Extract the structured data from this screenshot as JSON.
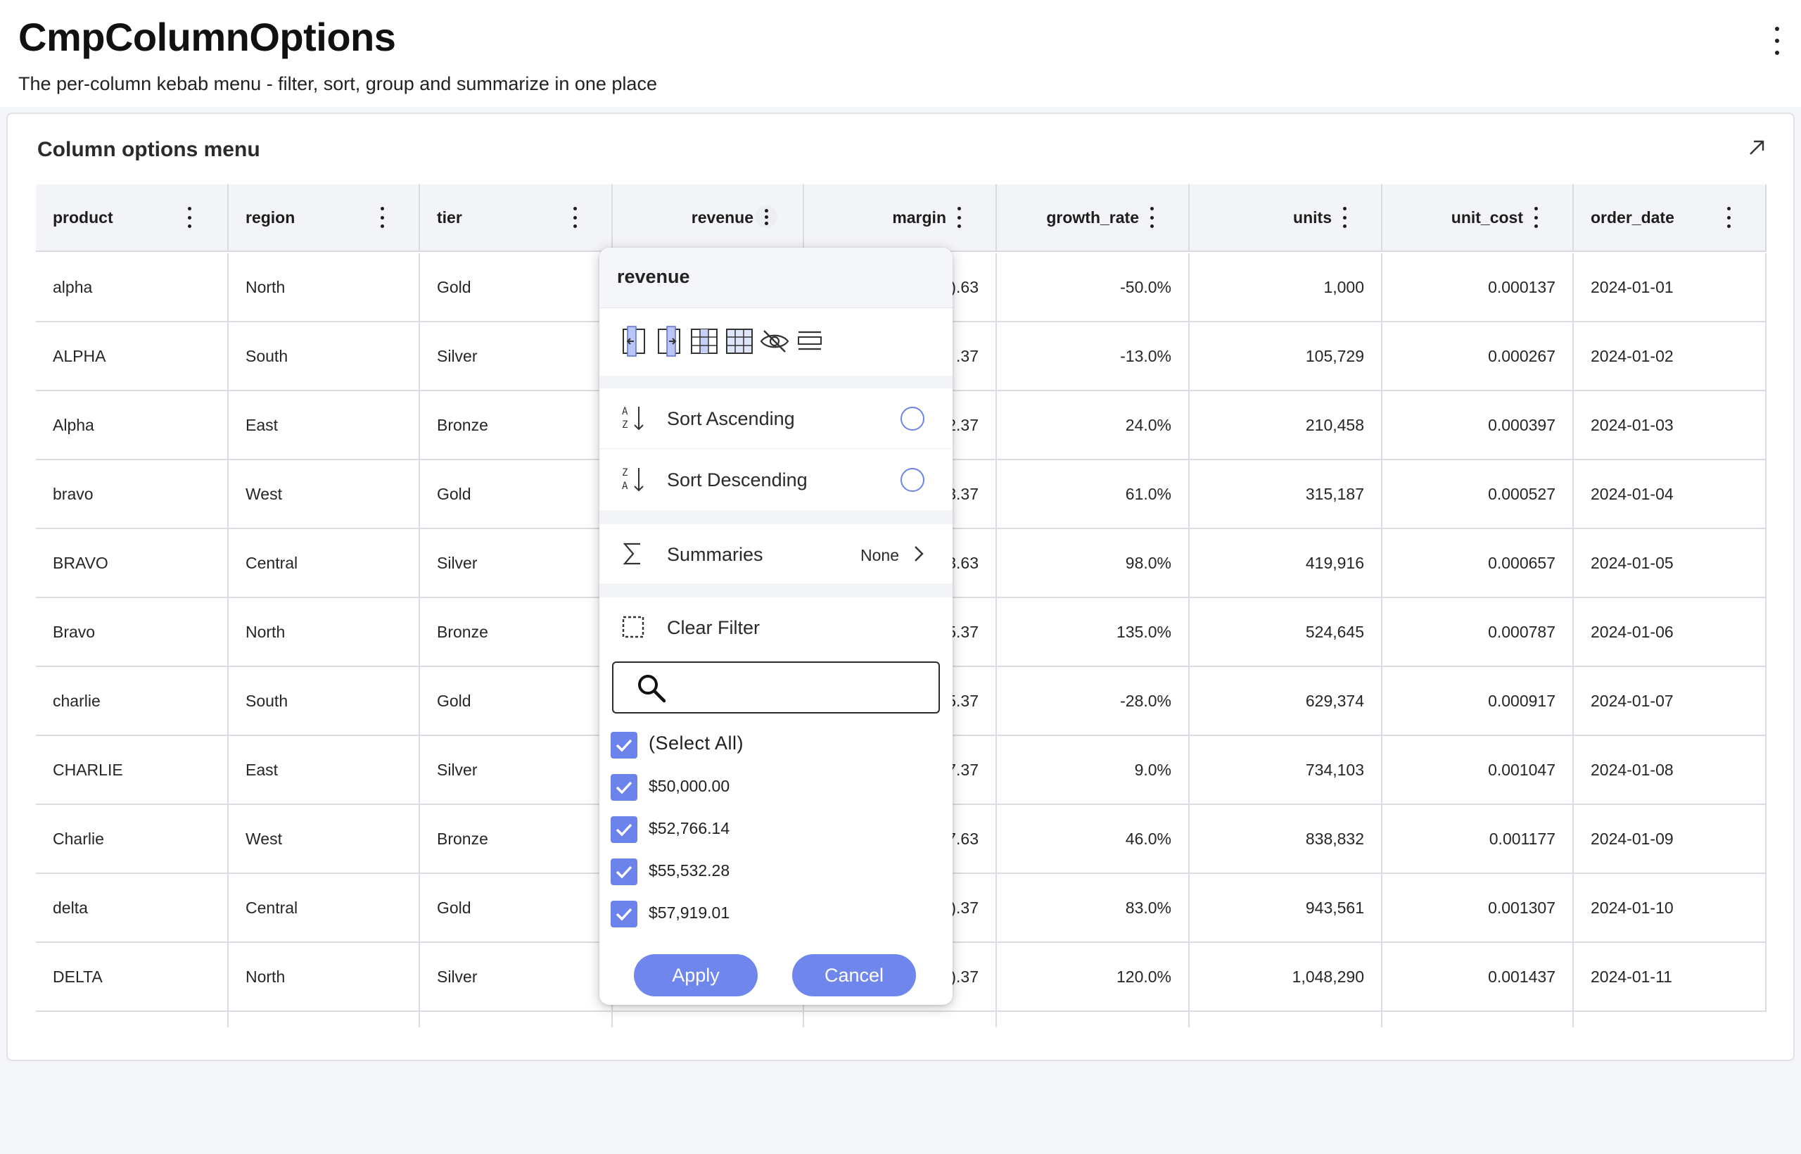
{
  "page": {
    "title": "CmpColumnOptions",
    "subtitle": "The per-column kebab menu - filter, sort, group and summarize in one place"
  },
  "card": {
    "title": "Column options menu"
  },
  "grid": {
    "columns": [
      {
        "label": "product",
        "align": "left"
      },
      {
        "label": "region",
        "align": "left"
      },
      {
        "label": "tier",
        "align": "left"
      },
      {
        "label": "revenue",
        "align": "right"
      },
      {
        "label": "margin",
        "align": "right"
      },
      {
        "label": "growth_rate",
        "align": "right"
      },
      {
        "label": "units",
        "align": "right"
      },
      {
        "label": "unit_cost",
        "align": "right"
      },
      {
        "label": "order_date",
        "align": "left"
      }
    ],
    "rows": [
      [
        "alpha",
        "North",
        "Gold",
        "",
        ").63",
        "-50.0%",
        "1,000",
        "0.000137",
        "2024-01-01"
      ],
      [
        "ALPHA",
        "South",
        "Silver",
        "",
        ".37",
        "-13.0%",
        "105,729",
        "0.000267",
        "2024-01-02"
      ],
      [
        "Alpha",
        "East",
        "Bronze",
        "",
        "2.37",
        "24.0%",
        "210,458",
        "0.000397",
        "2024-01-03"
      ],
      [
        "bravo",
        "West",
        "Gold",
        "",
        "3.37",
        "61.0%",
        "315,187",
        "0.000527",
        "2024-01-04"
      ],
      [
        "BRAVO",
        "Central",
        "Silver",
        "",
        "3.63",
        "98.0%",
        "419,916",
        "0.000657",
        "2024-01-05"
      ],
      [
        "Bravo",
        "North",
        "Bronze",
        "",
        "5.37",
        "135.0%",
        "524,645",
        "0.000787",
        "2024-01-06"
      ],
      [
        "charlie",
        "South",
        "Gold",
        "",
        "5.37",
        "-28.0%",
        "629,374",
        "0.000917",
        "2024-01-07"
      ],
      [
        "CHARLIE",
        "East",
        "Silver",
        "",
        "7.37",
        "9.0%",
        "734,103",
        "0.001047",
        "2024-01-08"
      ],
      [
        "Charlie",
        "West",
        "Bronze",
        "",
        "7.63",
        "46.0%",
        "838,832",
        "0.001177",
        "2024-01-09"
      ],
      [
        "delta",
        "Central",
        "Gold",
        "",
        ").37",
        "83.0%",
        "943,561",
        "0.001307",
        "2024-01-10"
      ],
      [
        "DELTA",
        "North",
        "Silver",
        "",
        ").37",
        "120.0%",
        "1,048,290",
        "0.001437",
        "2024-01-11"
      ]
    ]
  },
  "column_menu": {
    "title": "revenue",
    "toolbar_icons": [
      "pin-left-icon",
      "pin-right-icon",
      "column-grid-icon",
      "grid-icon",
      "hide-icon",
      "group-icon"
    ],
    "sort_ascending_label": "Sort Ascending",
    "sort_descending_label": "Sort Descending",
    "summaries_label": "Summaries",
    "summaries_value": "None",
    "clear_filter_label": "Clear Filter",
    "search": {
      "value": "",
      "placeholder": ""
    },
    "select_all_label": "(Select All)",
    "filter_values": [
      "$50,000.00",
      "$52,766.14",
      "$55,532.28",
      "$57,919.01"
    ],
    "apply_label": "Apply",
    "cancel_label": "Cancel"
  },
  "colors": {
    "accent": "#6f86ec",
    "checkbox": "#6b83ea",
    "header_bg": "#f3f4f7"
  }
}
